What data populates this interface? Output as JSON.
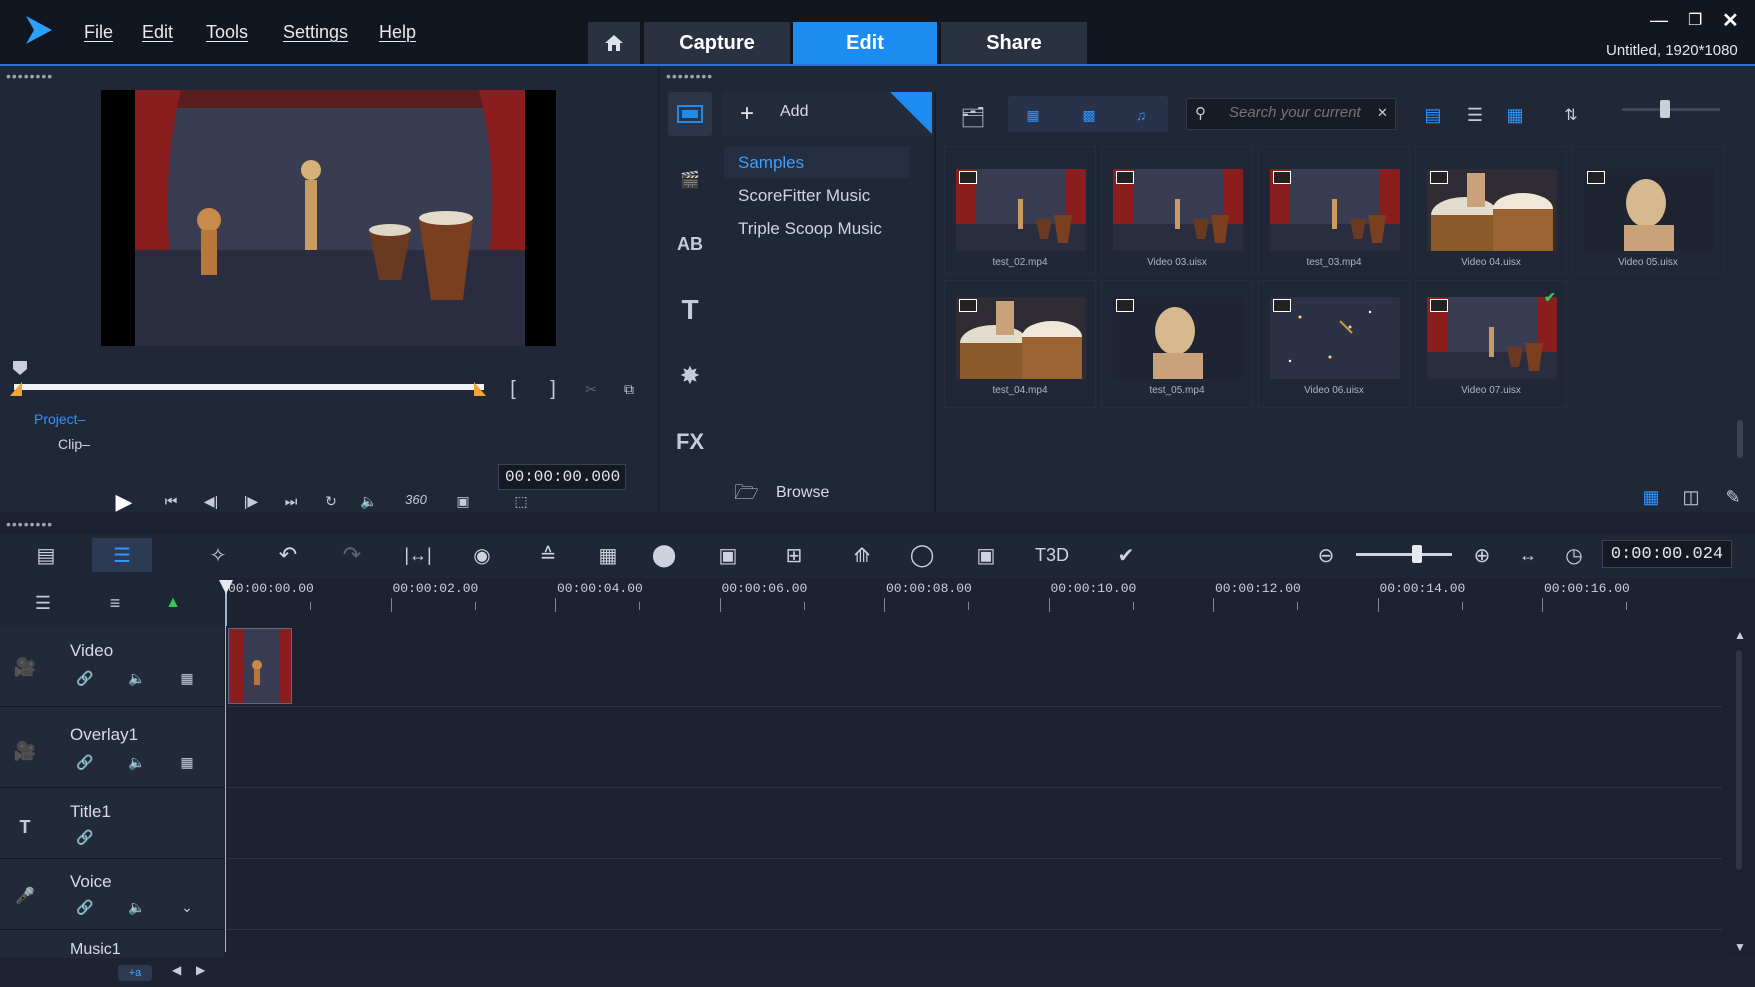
{
  "app": {
    "menu": [
      "File",
      "Edit",
      "Tools",
      "Settings",
      "Help"
    ],
    "tabs": [
      "Capture",
      "Edit",
      "Share"
    ],
    "project_info": "Untitled, 1920*1080"
  },
  "player": {
    "mode_project": "Project–",
    "mode_clip": "Clip–",
    "timecode": "00:00:00.000"
  },
  "library": {
    "add_label": "Add",
    "folders": [
      "Samples",
      "ScoreFitter Music",
      "Triple Scoop Music"
    ],
    "browse_label": "Browse",
    "search_placeholder": "Search your current",
    "items": [
      {
        "name": "test_02.mp4",
        "scene": "stage",
        "selected": false
      },
      {
        "name": "Video 03.uisx",
        "scene": "stage",
        "selected": false
      },
      {
        "name": "test_03.mp4",
        "scene": "stage",
        "selected": false
      },
      {
        "name": "Video 04.uisx",
        "scene": "drums",
        "selected": false
      },
      {
        "name": "Video 05.uisx",
        "scene": "mannequin",
        "selected": false
      },
      {
        "name": "test_04.mp4",
        "scene": "drums",
        "selected": false
      },
      {
        "name": "test_05.mp4",
        "scene": "mannequin",
        "selected": false
      },
      {
        "name": "Video 06.uisx",
        "scene": "space",
        "selected": false
      },
      {
        "name": "Video 07.uisx",
        "scene": "stage",
        "selected": true
      }
    ]
  },
  "timeline": {
    "timecode": "0:00:00.024",
    "ruler": [
      "00:00:00.00",
      "00:00:02.00",
      "00:00:04.00",
      "00:00:06.00",
      "00:00:08.00",
      "00:00:10.00",
      "00:00:12.00",
      "00:00:14.00",
      "00:00:16.00"
    ],
    "tracks": [
      "Video",
      "Overlay1",
      "Title1",
      "Voice",
      "Music1"
    ],
    "add_track": "+a"
  },
  "colors": {
    "accent": "#1c8cf0",
    "bg": "#1b2130",
    "panel": "#202736"
  }
}
